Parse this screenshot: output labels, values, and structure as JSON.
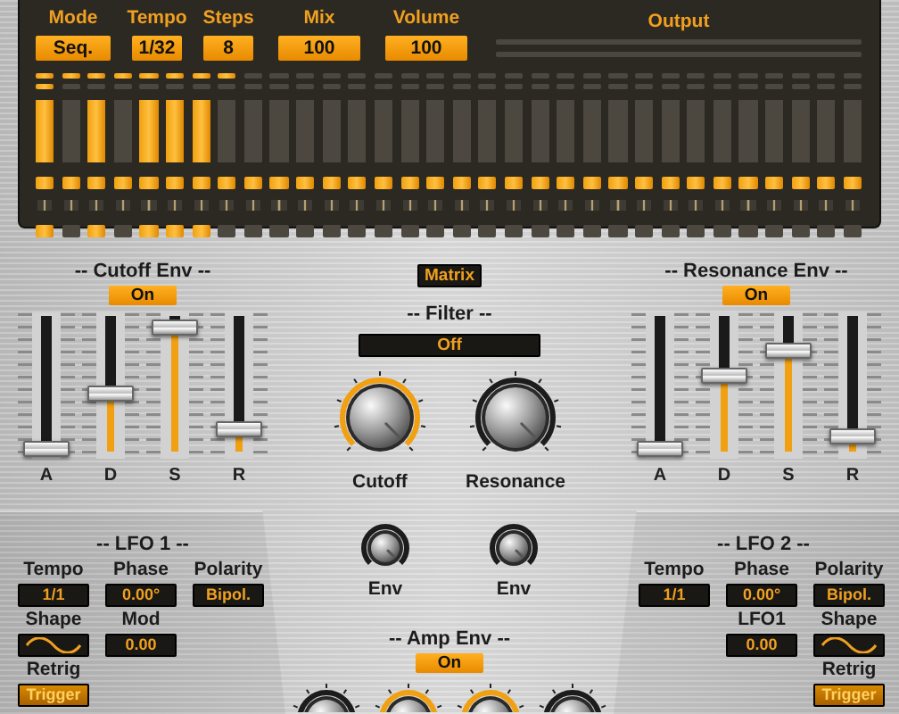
{
  "sequencer": {
    "controls": [
      {
        "label": "Mode",
        "value": "Seq."
      },
      {
        "label": "Tempo",
        "value": "1/32"
      },
      {
        "label": "Steps",
        "value": "8"
      },
      {
        "label": "Mix",
        "value": "100"
      },
      {
        "label": "Volume",
        "value": "100"
      }
    ],
    "output": {
      "label": "Output"
    },
    "steps": [
      {
        "in_range": true,
        "current": true,
        "gate": true
      },
      {
        "in_range": true,
        "current": false,
        "gate": false
      },
      {
        "in_range": true,
        "current": false,
        "gate": true
      },
      {
        "in_range": true,
        "current": false,
        "gate": false
      },
      {
        "in_range": true,
        "current": false,
        "gate": true
      },
      {
        "in_range": true,
        "current": false,
        "gate": true
      },
      {
        "in_range": true,
        "current": false,
        "gate": true
      },
      {
        "in_range": true,
        "current": false,
        "gate": false
      },
      {
        "in_range": false,
        "current": false,
        "gate": false
      },
      {
        "in_range": false,
        "current": false,
        "gate": false
      },
      {
        "in_range": false,
        "current": false,
        "gate": false
      },
      {
        "in_range": false,
        "current": false,
        "gate": false
      },
      {
        "in_range": false,
        "current": false,
        "gate": false
      },
      {
        "in_range": false,
        "current": false,
        "gate": false
      },
      {
        "in_range": false,
        "current": false,
        "gate": false
      },
      {
        "in_range": false,
        "current": false,
        "gate": false
      },
      {
        "in_range": false,
        "current": false,
        "gate": false
      },
      {
        "in_range": false,
        "current": false,
        "gate": false
      },
      {
        "in_range": false,
        "current": false,
        "gate": false
      },
      {
        "in_range": false,
        "current": false,
        "gate": false
      },
      {
        "in_range": false,
        "current": false,
        "gate": false
      },
      {
        "in_range": false,
        "current": false,
        "gate": false
      },
      {
        "in_range": false,
        "current": false,
        "gate": false
      },
      {
        "in_range": false,
        "current": false,
        "gate": false
      },
      {
        "in_range": false,
        "current": false,
        "gate": false
      },
      {
        "in_range": false,
        "current": false,
        "gate": false
      },
      {
        "in_range": false,
        "current": false,
        "gate": false
      },
      {
        "in_range": false,
        "current": false,
        "gate": false
      },
      {
        "in_range": false,
        "current": false,
        "gate": false
      },
      {
        "in_range": false,
        "current": false,
        "gate": false
      },
      {
        "in_range": false,
        "current": false,
        "gate": false
      },
      {
        "in_range": false,
        "current": false,
        "gate": false
      }
    ]
  },
  "cutoff_env": {
    "title": "-- Cutoff Env --",
    "toggle": {
      "label": "On",
      "on": true
    },
    "sliders": [
      {
        "label": "A",
        "level": 0
      },
      {
        "label": "D",
        "level": 0.45
      },
      {
        "label": "S",
        "level": 1
      },
      {
        "label": "R",
        "level": 0.15
      }
    ]
  },
  "filter": {
    "matrix_button": "Matrix",
    "title": "-- Filter --",
    "mode": "Off",
    "knobs": [
      {
        "label": "Cutoff",
        "active": true
      },
      {
        "label": "Resonance",
        "active": false
      }
    ],
    "env_knobs": [
      {
        "label": "Env",
        "active": false
      },
      {
        "label": "Env",
        "active": false
      }
    ]
  },
  "resonance_env": {
    "title": "-- Resonance Env --",
    "toggle": {
      "label": "On",
      "on": true
    },
    "sliders": [
      {
        "label": "A",
        "level": 0
      },
      {
        "label": "D",
        "level": 0.6
      },
      {
        "label": "S",
        "level": 0.8
      },
      {
        "label": "R",
        "level": 0.1
      }
    ]
  },
  "lfo1": {
    "title": "-- LFO 1 --",
    "rows": [
      [
        {
          "label": "Tempo",
          "kind": "value",
          "value": "1/1"
        },
        {
          "label": "Phase",
          "kind": "value",
          "value": "0.00°"
        },
        {
          "label": "Polarity",
          "kind": "value",
          "value": "Bipol."
        }
      ],
      [
        {
          "label": "Shape",
          "kind": "wave"
        },
        {
          "label": "Mod",
          "kind": "value",
          "value": "0.00"
        }
      ],
      [
        {
          "label": "Retrig",
          "kind": "button",
          "value": "Trigger"
        }
      ]
    ]
  },
  "lfo2": {
    "title": "-- LFO 2 --",
    "rows": [
      [
        {
          "label": "Tempo",
          "kind": "value",
          "value": "1/1"
        },
        {
          "label": "Phase",
          "kind": "value",
          "value": "0.00°"
        },
        {
          "label": "Polarity",
          "kind": "value",
          "value": "Bipol."
        }
      ],
      [
        "",
        {
          "label": "LFO1",
          "kind": "value",
          "value": "0.00"
        },
        {
          "label": "Shape",
          "kind": "wave"
        }
      ],
      [
        "",
        "",
        {
          "label": "Retrig",
          "kind": "button",
          "value": "Trigger"
        }
      ]
    ]
  },
  "amp_env": {
    "title": "-- Amp Env --",
    "toggle": {
      "label": "On",
      "on": true
    },
    "knobs": [
      {
        "active": false
      },
      {
        "active": true
      },
      {
        "active": true
      },
      {
        "active": false
      }
    ]
  }
}
